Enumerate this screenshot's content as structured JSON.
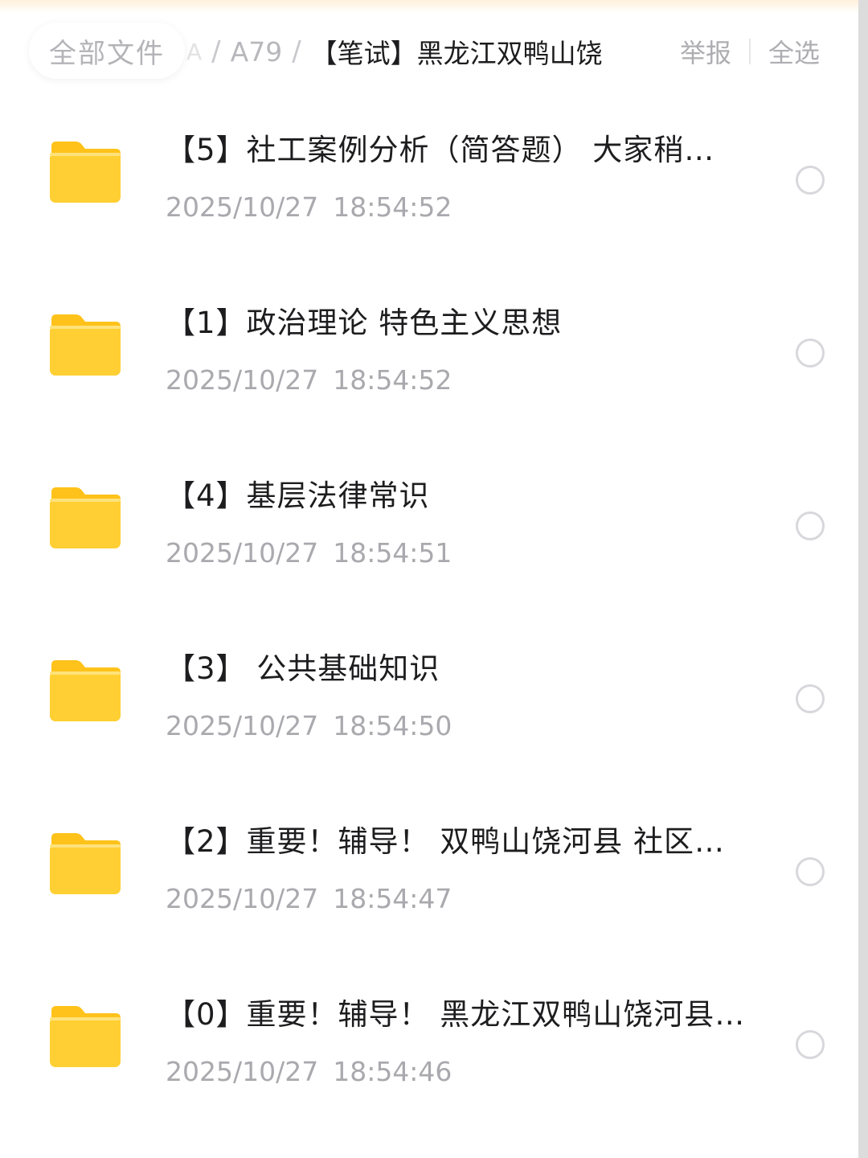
{
  "header": {
    "root_label": "全部文件",
    "ghost_crumb": "A",
    "separator": "/",
    "path_item": "A79",
    "current_folder": "【笔试】黑龙江双鸭山饶",
    "report_label": "举报",
    "select_all_label": "全选"
  },
  "colors": {
    "folder": "#FFCB2E",
    "folder_tab": "#FFC21A",
    "text_primary": "#1D1D1F",
    "text_secondary": "#A9A9AE"
  },
  "files": [
    {
      "name": "【5】社工案例分析（简答题） 大家稍…",
      "date": "2025/10/27",
      "time": "18:54:52",
      "icon": "folder-icon"
    },
    {
      "name": "【1】政治理论 特色主义思想",
      "date": "2025/10/27",
      "time": "18:54:52",
      "icon": "folder-icon"
    },
    {
      "name": "【4】基层法律常识",
      "date": "2025/10/27",
      "time": "18:54:51",
      "icon": "folder-icon"
    },
    {
      "name": "【3】 公共基础知识",
      "date": "2025/10/27",
      "time": "18:54:50",
      "icon": "folder-icon"
    },
    {
      "name": "【2】重要！辅导！ 双鸭山饶河县 社区…",
      "date": "2025/10/27",
      "time": "18:54:47",
      "icon": "folder-icon"
    },
    {
      "name": "【0】重要！辅导！ 黑龙江双鸭山饶河县…",
      "date": "2025/10/27",
      "time": "18:54:46",
      "icon": "folder-icon"
    }
  ]
}
